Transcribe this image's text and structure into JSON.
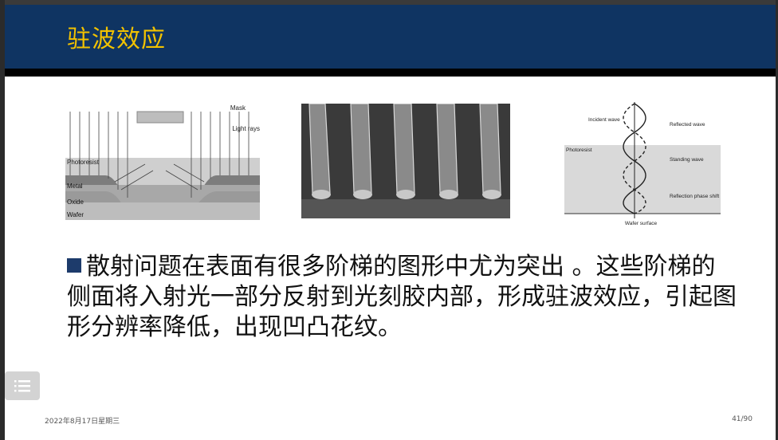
{
  "slide": {
    "title": "驻波效应",
    "body": "散射问题在表面有很多阶梯的图形中尤为突出 。这些阶梯的侧面将入射光一部分反射到光刻胶内部，形成驻波效应，引起图形分辨率降低，出现凹凸花纹。",
    "footer_date": "2022年8月17日星期三",
    "page_number": "41/90"
  },
  "figure1": {
    "mask": "Mask",
    "light_rays": "Light rays",
    "photoresist": "Photoresist",
    "metal": "Metal",
    "oxide": "Oxide",
    "wafer": "Wafer"
  },
  "figure3": {
    "incident_wave": "Incident wave",
    "reflected_wave": "Reflected wave",
    "photoresist": "Photoresist",
    "standing_wave": "Standing wave",
    "reflection_phase_shift": "Reflection phase shift",
    "wafer_surface": "Wafer surface"
  },
  "icons": {
    "menu": "list-icon"
  },
  "colors": {
    "banner": "#0f3462",
    "title": "#f2c200",
    "bullet": "#1d3b6b"
  }
}
